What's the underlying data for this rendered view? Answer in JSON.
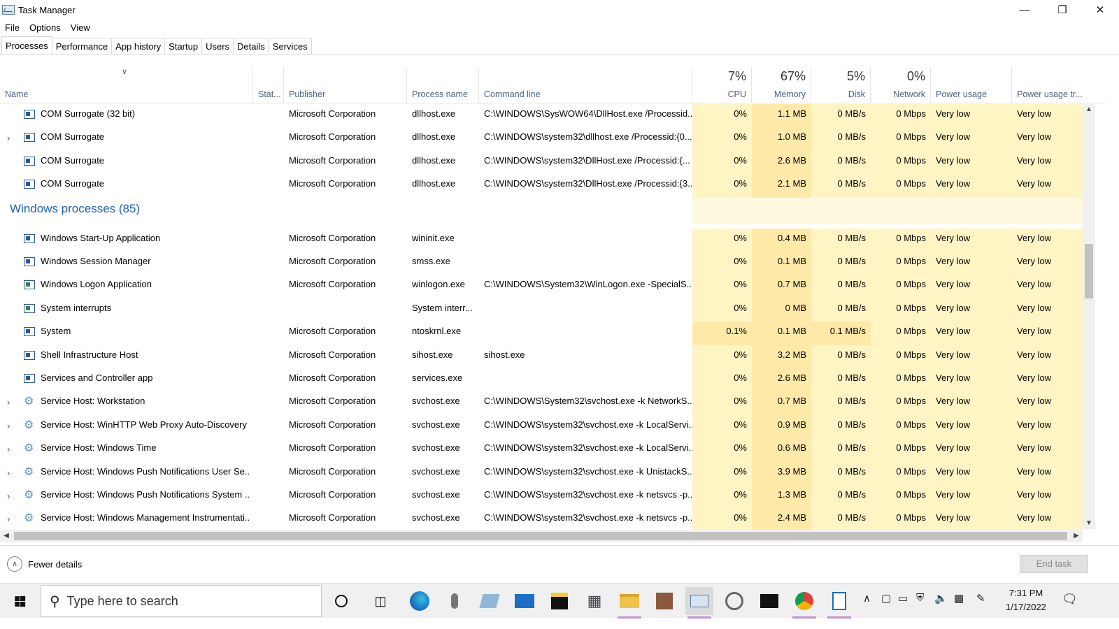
{
  "window": {
    "title": "Task Manager",
    "minimize": "—",
    "maximize": "❐",
    "close": "✕"
  },
  "menu": [
    "File",
    "Options",
    "View"
  ],
  "tabs": [
    "Processes",
    "Performance",
    "App history",
    "Startup",
    "Users",
    "Details",
    "Services"
  ],
  "columns": {
    "name": "Name",
    "status": "Stat...",
    "publisher": "Publisher",
    "process": "Process name",
    "cmd": "Command line",
    "cpu": "CPU",
    "cpu_pct": "7%",
    "memory": "Memory",
    "memory_pct": "67%",
    "disk": "Disk",
    "disk_pct": "5%",
    "network": "Network",
    "network_pct": "0%",
    "power": "Power usage",
    "power_trend": "Power usage tr..."
  },
  "rows_top": [
    {
      "name": "COM Surrogate (32 bit)",
      "expandable": false,
      "icon": "app-icon",
      "publisher": "Microsoft Corporation",
      "process": "dllhost.exe",
      "cmd": "C:\\WINDOWS\\SysWOW64\\DllHost.exe /Processid...",
      "cpu": "0%",
      "memory": "1.1 MB",
      "disk": "0 MB/s",
      "network": "0 Mbps",
      "power": "Very low",
      "trend": "Very low"
    },
    {
      "name": "COM Surrogate",
      "expandable": true,
      "icon": "app-icon",
      "publisher": "Microsoft Corporation",
      "process": "dllhost.exe",
      "cmd": "C:\\WINDOWS\\system32\\dllhost.exe /Processid:{0...",
      "cpu": "0%",
      "memory": "1.0 MB",
      "disk": "0 MB/s",
      "network": "0 Mbps",
      "power": "Very low",
      "trend": "Very low"
    },
    {
      "name": "COM Surrogate",
      "expandable": false,
      "icon": "app-icon",
      "publisher": "Microsoft Corporation",
      "process": "dllhost.exe",
      "cmd": "C:\\WINDOWS\\system32\\DllHost.exe /Processid:{...",
      "cpu": "0%",
      "memory": "2.6 MB",
      "disk": "0 MB/s",
      "network": "0 Mbps",
      "power": "Very low",
      "trend": "Very low"
    },
    {
      "name": "COM Surrogate",
      "expandable": false,
      "icon": "app-icon",
      "publisher": "Microsoft Corporation",
      "process": "dllhost.exe",
      "cmd": "C:\\WINDOWS\\system32\\DllHost.exe /Processid:{3...",
      "cpu": "0%",
      "memory": "2.1 MB",
      "disk": "0 MB/s",
      "network": "0 Mbps",
      "power": "Very low",
      "trend": "Very low"
    }
  ],
  "group": {
    "title": "Windows processes (85)"
  },
  "rows_win": [
    {
      "name": "Windows Start-Up Application",
      "expandable": false,
      "icon": "app-icon",
      "publisher": "Microsoft Corporation",
      "process": "wininit.exe",
      "cmd": "",
      "cpu": "0%",
      "memory": "0.4 MB",
      "disk": "0 MB/s",
      "network": "0 Mbps",
      "power": "Very low",
      "trend": "Very low"
    },
    {
      "name": "Windows Session Manager",
      "expandable": false,
      "icon": "app-icon",
      "publisher": "Microsoft Corporation",
      "process": "smss.exe",
      "cmd": "",
      "cpu": "0%",
      "memory": "0.1 MB",
      "disk": "0 MB/s",
      "network": "0 Mbps",
      "power": "Very low",
      "trend": "Very low"
    },
    {
      "name": "Windows Logon Application",
      "expandable": false,
      "icon": "logon-icon",
      "publisher": "Microsoft Corporation",
      "process": "winlogon.exe",
      "cmd": "C:\\WINDOWS\\System32\\WinLogon.exe -SpecialS...",
      "cpu": "0%",
      "memory": "0.7 MB",
      "disk": "0 MB/s",
      "network": "0 Mbps",
      "power": "Very low",
      "trend": "Very low"
    },
    {
      "name": "System interrupts",
      "expandable": false,
      "icon": "logon-icon",
      "publisher": "",
      "process": "System interr...",
      "cmd": "",
      "cpu": "0%",
      "memory": "0 MB",
      "disk": "0 MB/s",
      "network": "0 Mbps",
      "power": "Very low",
      "trend": "Very low"
    },
    {
      "name": "System",
      "expandable": false,
      "icon": "app-icon",
      "publisher": "Microsoft Corporation",
      "process": "ntoskrnl.exe",
      "cmd": "",
      "cpu": "0.1%",
      "memory": "0.1 MB",
      "disk": "0.1 MB/s",
      "network": "0 Mbps",
      "power": "Very low",
      "trend": "Very low",
      "hot": true
    },
    {
      "name": "Shell Infrastructure Host",
      "expandable": false,
      "icon": "app-icon",
      "publisher": "Microsoft Corporation",
      "process": "sihost.exe",
      "cmd": "sihost.exe",
      "cpu": "0%",
      "memory": "3.2 MB",
      "disk": "0 MB/s",
      "network": "0 Mbps",
      "power": "Very low",
      "trend": "Very low"
    },
    {
      "name": "Services and Controller app",
      "expandable": false,
      "icon": "app-icon",
      "publisher": "Microsoft Corporation",
      "process": "services.exe",
      "cmd": "",
      "cpu": "0%",
      "memory": "2.6 MB",
      "disk": "0 MB/s",
      "network": "0 Mbps",
      "power": "Very low",
      "trend": "Very low"
    },
    {
      "name": "Service Host: Workstation",
      "expandable": true,
      "icon": "gear-icon",
      "publisher": "Microsoft Corporation",
      "process": "svchost.exe",
      "cmd": "C:\\WINDOWS\\System32\\svchost.exe -k NetworkS...",
      "cpu": "0%",
      "memory": "0.7 MB",
      "disk": "0 MB/s",
      "network": "0 Mbps",
      "power": "Very low",
      "trend": "Very low"
    },
    {
      "name": "Service Host: WinHTTP Web Proxy Auto-Discovery ...",
      "expandable": true,
      "icon": "gear-icon",
      "publisher": "Microsoft Corporation",
      "process": "svchost.exe",
      "cmd": "C:\\WINDOWS\\system32\\svchost.exe -k LocalServi...",
      "cpu": "0%",
      "memory": "0.9 MB",
      "disk": "0 MB/s",
      "network": "0 Mbps",
      "power": "Very low",
      "trend": "Very low"
    },
    {
      "name": "Service Host: Windows Time",
      "expandable": true,
      "icon": "gear-icon",
      "publisher": "Microsoft Corporation",
      "process": "svchost.exe",
      "cmd": "C:\\WINDOWS\\system32\\svchost.exe -k LocalServi...",
      "cpu": "0%",
      "memory": "0.6 MB",
      "disk": "0 MB/s",
      "network": "0 Mbps",
      "power": "Very low",
      "trend": "Very low"
    },
    {
      "name": "Service Host: Windows Push Notifications User Se...",
      "expandable": true,
      "icon": "gear-icon",
      "publisher": "Microsoft Corporation",
      "process": "svchost.exe",
      "cmd": "C:\\WINDOWS\\system32\\svchost.exe -k UnistackS...",
      "cpu": "0%",
      "memory": "3.9 MB",
      "disk": "0 MB/s",
      "network": "0 Mbps",
      "power": "Very low",
      "trend": "Very low"
    },
    {
      "name": "Service Host: Windows Push Notifications System ...",
      "expandable": true,
      "icon": "gear-icon",
      "publisher": "Microsoft Corporation",
      "process": "svchost.exe",
      "cmd": "C:\\WINDOWS\\system32\\svchost.exe -k netsvcs -p...",
      "cpu": "0%",
      "memory": "1.3 MB",
      "disk": "0 MB/s",
      "network": "0 Mbps",
      "power": "Very low",
      "trend": "Very low"
    },
    {
      "name": "Service Host: Windows Management Instrumentati...",
      "expandable": true,
      "icon": "gear-icon",
      "publisher": "Microsoft Corporation",
      "process": "svchost.exe",
      "cmd": "C:\\WINDOWS\\system32\\svchost.exe -k netsvcs -p...",
      "cpu": "0%",
      "memory": "2.4 MB",
      "disk": "0 MB/s",
      "network": "0 Mbps",
      "power": "Very low",
      "trend": "Very low"
    }
  ],
  "footer": {
    "fewer_details": "Fewer details",
    "end_task": "End task"
  },
  "taskbar": {
    "search_placeholder": "Type here to search",
    "time": "7:31 PM",
    "date": "1/17/2022"
  },
  "colors": {
    "heat_light": "#fff4c4",
    "heat_memory": "#ffe9a8",
    "group_title": "#1f5fb4"
  }
}
